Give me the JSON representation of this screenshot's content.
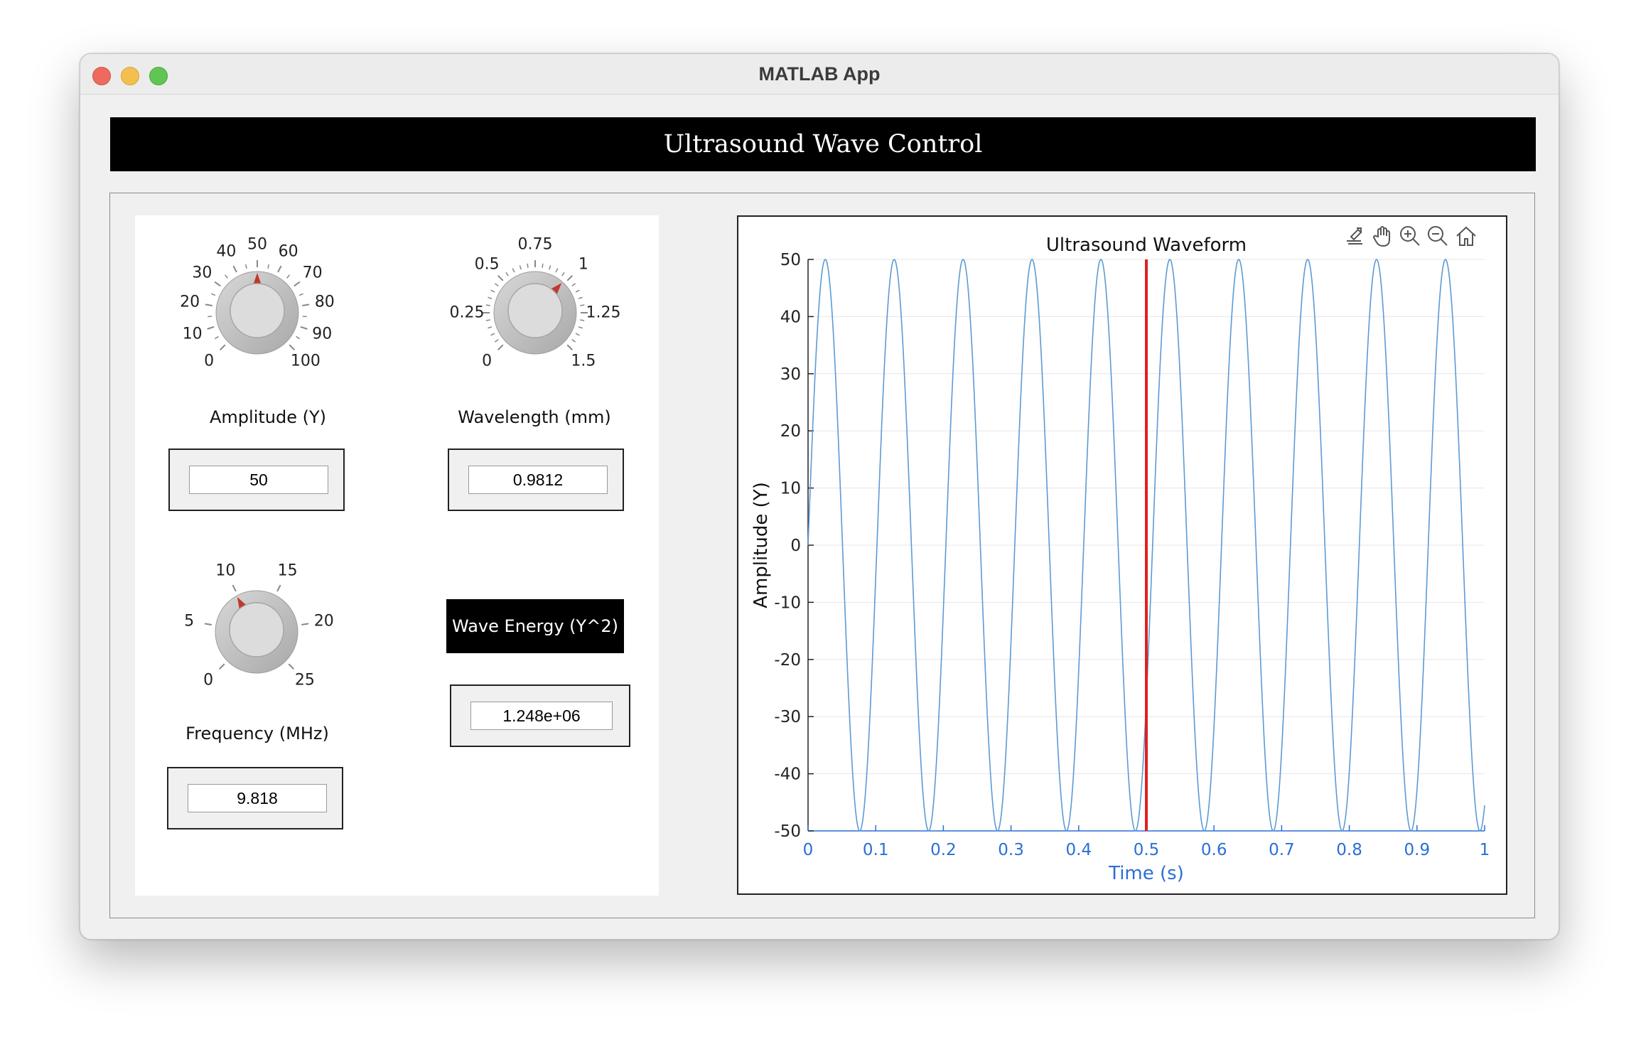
{
  "window": {
    "title": "MATLAB App"
  },
  "header": {
    "title": "Ultrasound Wave Control"
  },
  "knobs": {
    "amplitude": {
      "label": "Amplitude (Y)",
      "ticks": [
        "0",
        "10",
        "20",
        "30",
        "40",
        "50",
        "60",
        "70",
        "80",
        "90",
        "100"
      ],
      "min": 0,
      "max": 100,
      "value": 50,
      "field_value": "50"
    },
    "wavelength": {
      "label": "Wavelength (mm)",
      "ticks": [
        "0",
        "0.25",
        "0.5",
        "0.75",
        "1",
        "1.25",
        "1.5"
      ],
      "min": 0,
      "max": 1.5,
      "value": 0.9812,
      "field_value": "0.9812"
    },
    "frequency": {
      "label": "Frequency (MHz)",
      "ticks": [
        "0",
        "5",
        "10",
        "15",
        "20",
        "25"
      ],
      "min": 0,
      "max": 25,
      "value": 9.818,
      "field_value": "9.818"
    }
  },
  "energy": {
    "label": "Wave Energy (Y^2)",
    "value": "1.248e+06"
  },
  "toolbar": {
    "icons": [
      "export-icon",
      "pan-icon",
      "zoom-in-icon",
      "zoom-out-icon",
      "home-icon"
    ]
  },
  "chart_data": {
    "type": "line",
    "title": "Ultrasound Waveform",
    "xlabel": "Time (s)",
    "ylabel": "Amplitude (Y)",
    "xlim": [
      0,
      1
    ],
    "ylim": [
      -50,
      50
    ],
    "xticks": [
      "0",
      "0.1",
      "0.2",
      "0.3",
      "0.4",
      "0.5",
      "0.6",
      "0.7",
      "0.8",
      "0.9",
      "1"
    ],
    "yticks": [
      "50",
      "40",
      "30",
      "20",
      "10",
      "0",
      "-10",
      "-20",
      "-30",
      "-40",
      "-50"
    ],
    "grid": true,
    "series": [
      {
        "amplitude": 50,
        "frequency_hz": 9.818,
        "color": "#5b9bd5"
      }
    ],
    "marker_line": {
      "x": 0.5,
      "color": "#e02020"
    },
    "axis_color": "#2b6fd6"
  }
}
